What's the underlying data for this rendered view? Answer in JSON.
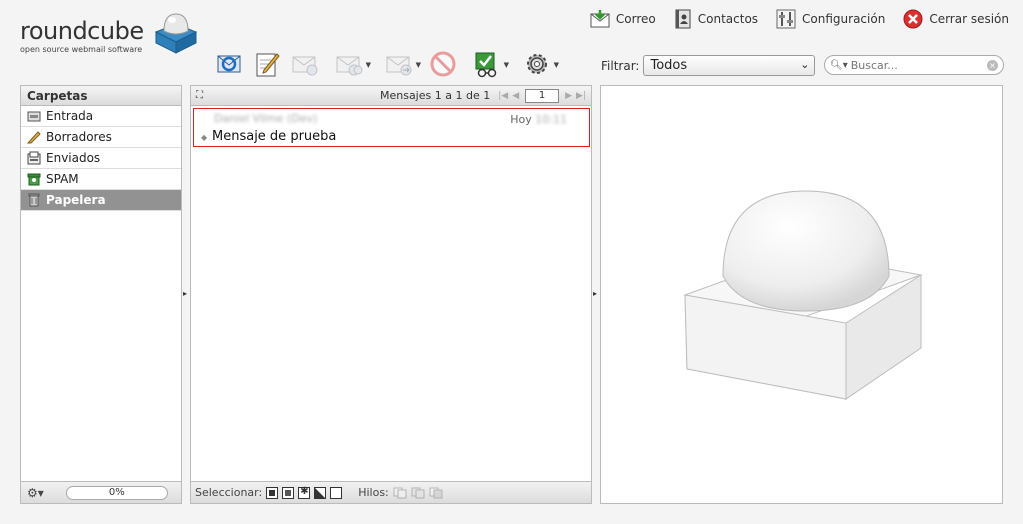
{
  "app": {
    "brand": "roundcube",
    "tagline": "open source webmail software"
  },
  "taskbar": {
    "mail": "Correo",
    "contacts": "Contactos",
    "settings": "Configuración",
    "logout": "Cerrar sesión"
  },
  "toolbar": {
    "icons": [
      "refresh-icon",
      "compose-icon",
      "reply-icon",
      "reply-all-icon",
      "forward-icon",
      "delete-icon",
      "mark-icon",
      "more-icon"
    ]
  },
  "filter": {
    "label": "Filtrar:",
    "selected": "Todos"
  },
  "search": {
    "placeholder": "Buscar..."
  },
  "folders": {
    "title": "Carpetas",
    "items": [
      {
        "label": "Entrada",
        "icon": "inbox-icon"
      },
      {
        "label": "Borradores",
        "icon": "drafts-icon"
      },
      {
        "label": "Enviados",
        "icon": "sent-icon"
      },
      {
        "label": "SPAM",
        "icon": "spam-icon"
      },
      {
        "label": "Papelera",
        "icon": "trash-icon",
        "selected": true
      }
    ],
    "quota": "0%"
  },
  "messagelist": {
    "count": "Mensajes 1 a 1 de 1",
    "page": "1",
    "messages": [
      {
        "from": "Daniel Vilme (Dev)",
        "date_prefix": "Hoy",
        "date_time": "10:11",
        "subject": "Mensaje de prueba"
      }
    ],
    "select_label": "Seleccionar:",
    "threads_label": "Hilos:"
  },
  "colors": {
    "selected_folder": "#929292",
    "message_border": "#dd2222",
    "logo_blue": "#2f7fb8"
  }
}
